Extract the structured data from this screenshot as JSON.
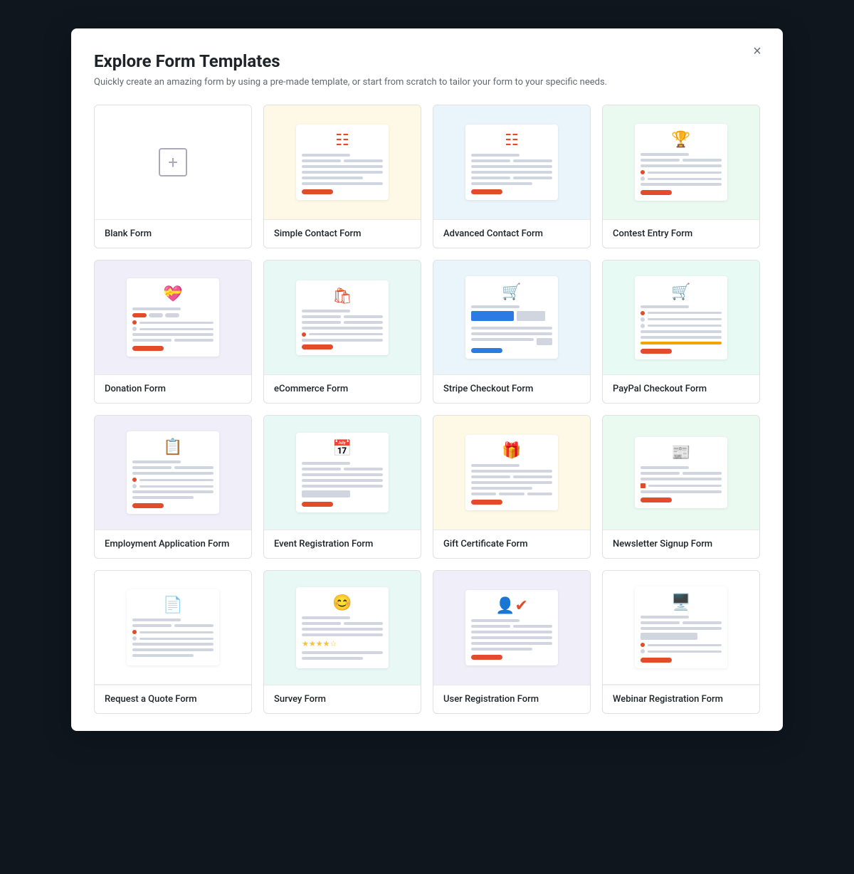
{
  "modal": {
    "title": "Explore Form Templates",
    "subtitle": "Quickly create an amazing form by using a pre-made template, or start from scratch to tailor your form to your specific needs.",
    "close_label": "×"
  },
  "templates": [
    {
      "id": "blank",
      "label": "Blank Form",
      "bg": "bg-white",
      "type": "blank"
    },
    {
      "id": "simple-contact",
      "label": "Simple Contact Form",
      "bg": "bg-yellow",
      "type": "contact-simple"
    },
    {
      "id": "advanced-contact",
      "label": "Advanced Contact Form",
      "bg": "bg-blue-light",
      "type": "contact-advanced"
    },
    {
      "id": "contest-entry",
      "label": "Contest Entry Form",
      "bg": "bg-green-light",
      "type": "contest"
    },
    {
      "id": "donation",
      "label": "Donation Form",
      "bg": "bg-purple-light",
      "type": "donation"
    },
    {
      "id": "ecommerce",
      "label": "eCommerce Form",
      "bg": "bg-teal-light",
      "type": "ecommerce"
    },
    {
      "id": "stripe-checkout",
      "label": "Stripe Checkout Form",
      "bg": "bg-blue-light",
      "type": "stripe"
    },
    {
      "id": "paypal-checkout",
      "label": "PayPal Checkout Form",
      "bg": "bg-mint",
      "type": "paypal"
    },
    {
      "id": "employment-application",
      "label": "Employment Application Form",
      "bg": "bg-purple-light",
      "type": "employment"
    },
    {
      "id": "event-registration",
      "label": "Event Registration Form",
      "bg": "bg-teal-light",
      "type": "event"
    },
    {
      "id": "gift-certificate",
      "label": "Gift Certificate Form",
      "bg": "bg-yellow",
      "type": "gift"
    },
    {
      "id": "newsletter-signup",
      "label": "Newsletter Signup Form",
      "bg": "bg-green-light",
      "type": "newsletter"
    },
    {
      "id": "request-quote",
      "label": "Request a Quote Form",
      "bg": "bg-white",
      "type": "quote"
    },
    {
      "id": "survey",
      "label": "Survey Form",
      "bg": "bg-teal-light",
      "type": "survey"
    },
    {
      "id": "user-registration",
      "label": "User Registration Form",
      "bg": "bg-purple-light",
      "type": "user-reg"
    },
    {
      "id": "webinar-registration",
      "label": "Webinar Registration Form",
      "bg": "bg-white",
      "type": "webinar"
    }
  ]
}
